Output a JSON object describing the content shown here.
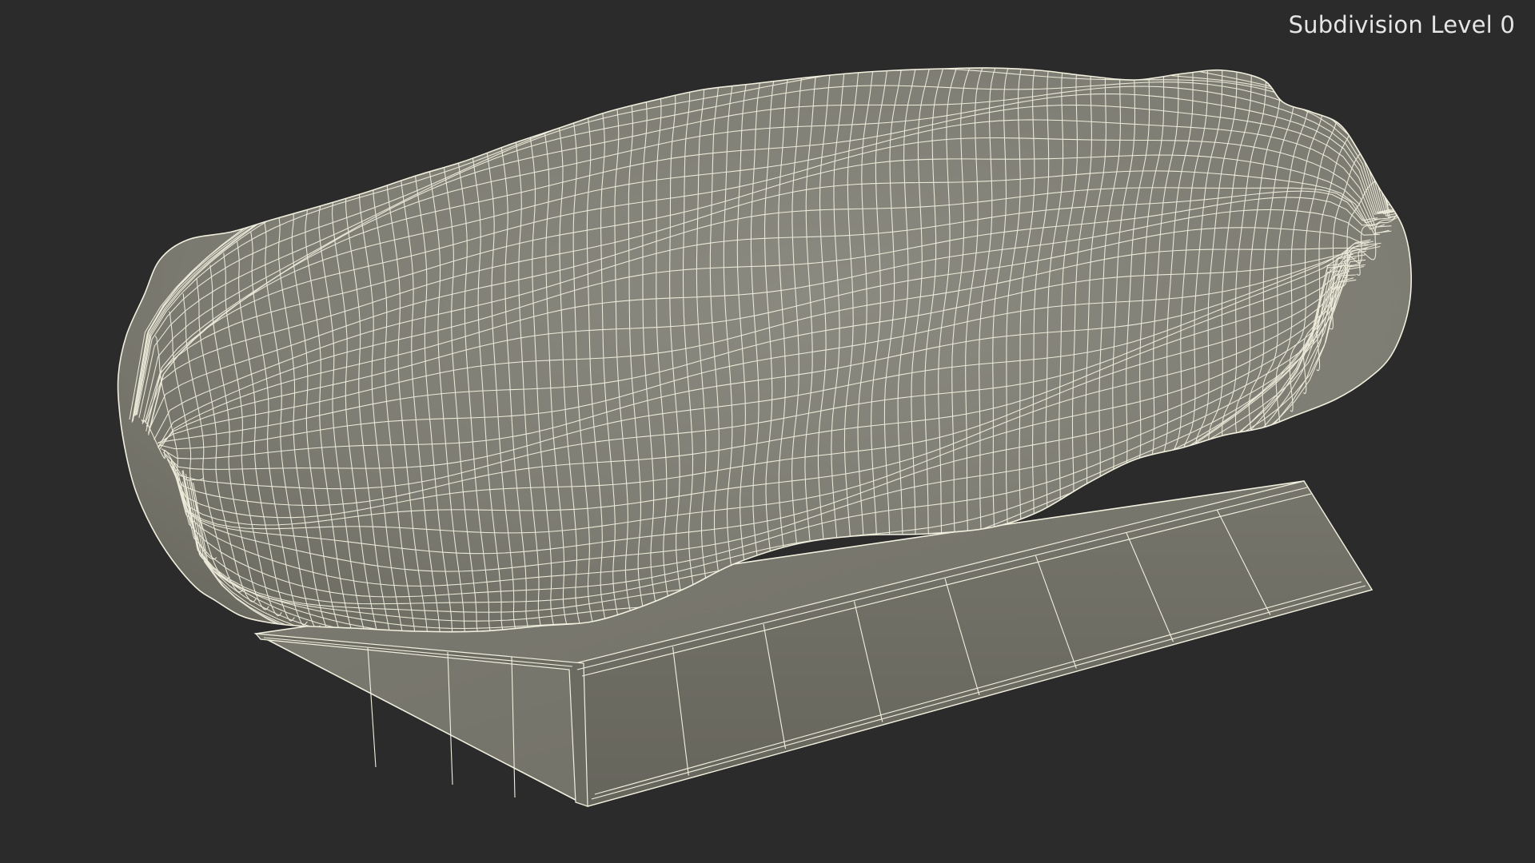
{
  "viewport": {
    "background_color": "#2b2b2b",
    "subdivision_label": "Subdivision Level 0"
  },
  "model": {
    "surface_color": "#7c7b71",
    "wire_color": "#f2f0df"
  }
}
